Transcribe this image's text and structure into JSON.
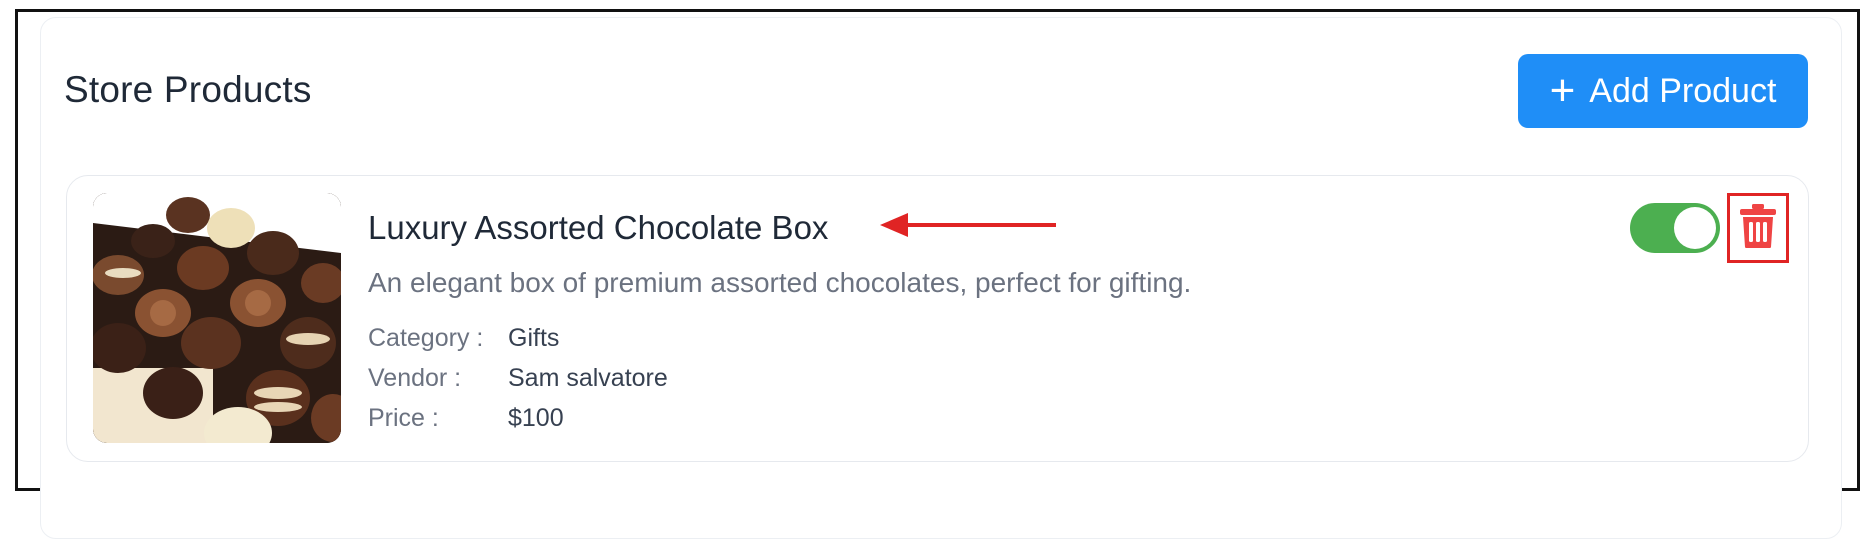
{
  "header": {
    "title": "Store Products",
    "add_button_label": "Add Product"
  },
  "product": {
    "name": "Luxury Assorted Chocolate Box",
    "description": "An elegant box of premium assorted chocolates, perfect for gifting.",
    "fields": [
      {
        "label": "Category :",
        "value": "Gifts"
      },
      {
        "label": "Vendor :",
        "value": "Sam salvatore"
      },
      {
        "label": "Price :",
        "value": "$100"
      }
    ],
    "active": true,
    "image": "assorted-chocolates-photo"
  },
  "icons": {
    "add": "plus-icon",
    "delete": "trash-icon",
    "annotation": "red-arrow-icon"
  },
  "colors": {
    "primary": "#1f8ef7",
    "toggle_on": "#4caf50",
    "danger": "#e02424"
  }
}
